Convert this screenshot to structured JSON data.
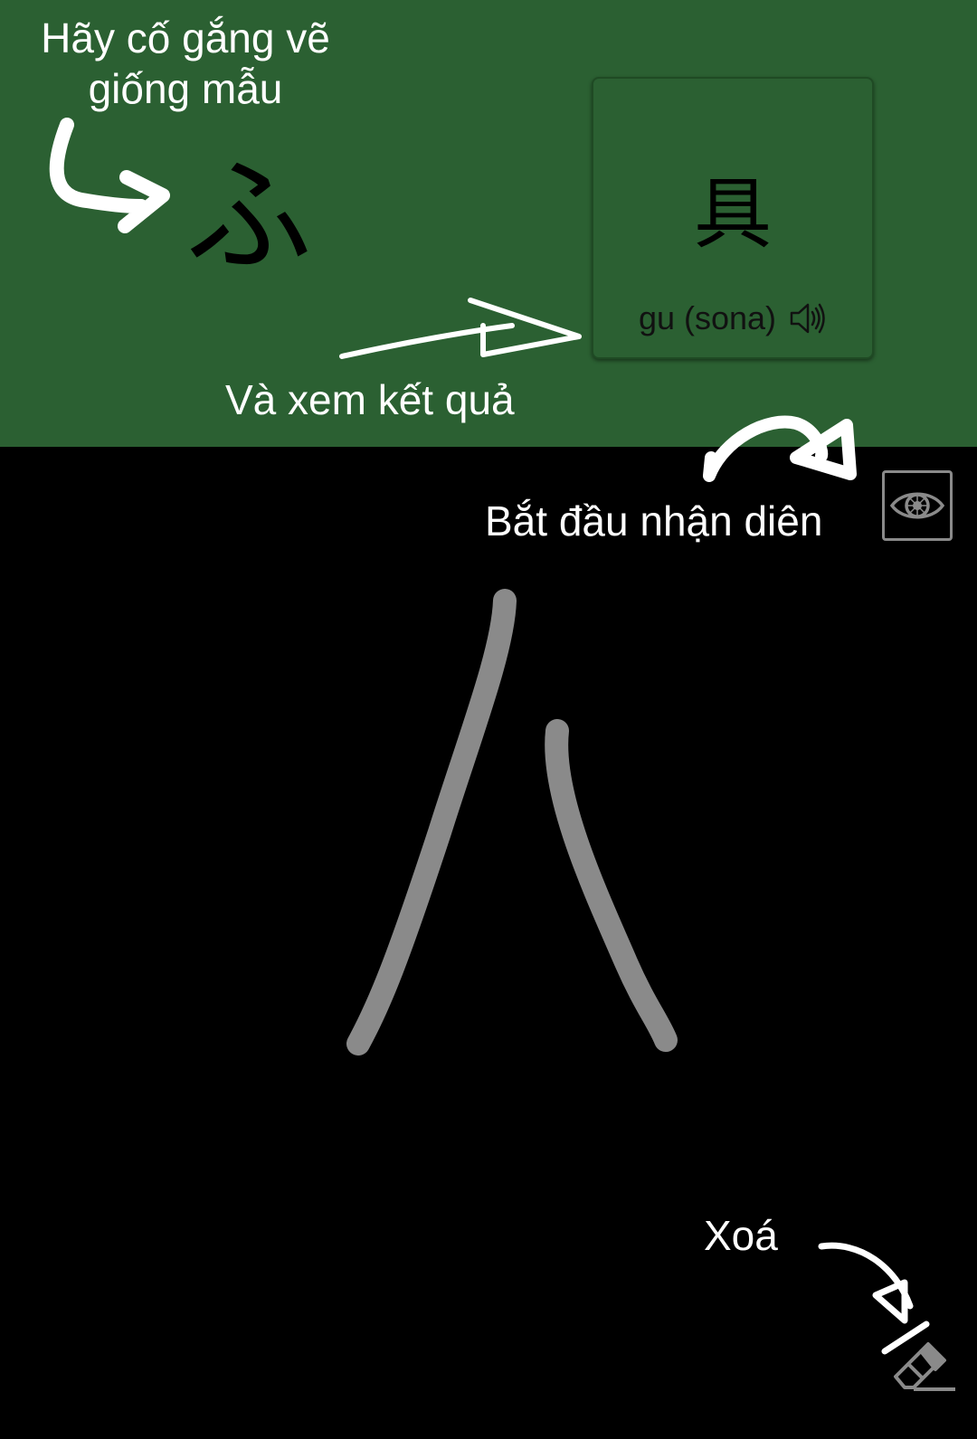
{
  "hints": {
    "draw_like_sample": "Hãy cố gắng vẽ giống mẫu",
    "see_result": "Và xem kết quả",
    "start_recognition": "Bắt đầu nhận diên",
    "clear": "Xoá"
  },
  "sample": {
    "character": "ふ"
  },
  "result_card": {
    "kanji": "具",
    "reading": "gu (sona)",
    "icon": "speaker-icon"
  },
  "toolbar": {
    "recognize_icon": "eye-icon",
    "eraser_icon": "eraser-icon"
  },
  "canvas": {
    "stroke_color": "#8a8a8a",
    "background": "#000000"
  },
  "colors": {
    "top_panel": "#2b6032",
    "hint_text": "#ffffff"
  }
}
